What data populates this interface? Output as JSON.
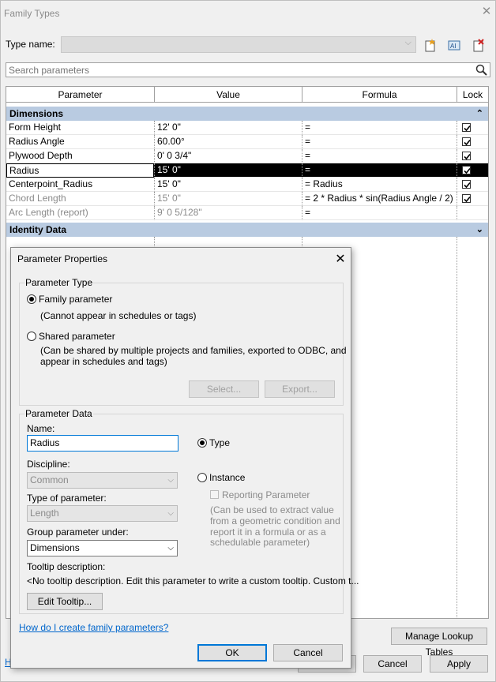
{
  "family_types": {
    "title": "Family Types",
    "type_name_label": "Type name:",
    "type_name_value": "",
    "search_placeholder": "Search parameters",
    "columns": [
      "Parameter",
      "Value",
      "Formula",
      "Lock"
    ],
    "groups": {
      "dimensions": "Dimensions",
      "identity": "Identity Data"
    },
    "rows": [
      {
        "parameter": "Form Height",
        "value": "12'  0\"",
        "formula": "=",
        "lock": true
      },
      {
        "parameter": "Radius Angle",
        "value": "60.00°",
        "formula": "=",
        "lock": true
      },
      {
        "parameter": "Plywood Depth",
        "value": "0'  0 3/4\"",
        "formula": "=",
        "lock": true
      },
      {
        "parameter": "Radius",
        "value": "15'  0\"",
        "formula": "=",
        "lock": true
      },
      {
        "parameter": "Centerpoint_Radius",
        "value": "15'  0\"",
        "formula": "= Radius",
        "lock": true
      },
      {
        "parameter": "Chord Length",
        "value": "15'  0\"",
        "formula": "= 2 * Radius * sin(Radius Angle / 2)",
        "lock": true
      },
      {
        "parameter": "Arc Length (report)",
        "value": "9'  0 5/128\"",
        "formula": "=",
        "lock": false
      }
    ],
    "manage_lookup_label": "Manage Lookup Tables",
    "ok_partial": "H",
    "cancel_label": "Cancel",
    "apply_label": "Apply"
  },
  "dialog": {
    "title": "Parameter Properties",
    "parameter_type_label": "Parameter Type",
    "family_param_label": "Family parameter",
    "family_param_note": "(Cannot appear in schedules or tags)",
    "shared_param_label": "Shared parameter",
    "shared_param_note_1": "(Can be shared by multiple projects and families, exported to ODBC, and",
    "shared_param_note_2": "appear in schedules and tags)",
    "select_label": "Select...",
    "export_label": "Export...",
    "parameter_data_label": "Parameter Data",
    "name_label": "Name:",
    "name_value": "Radius",
    "discipline_label": "Discipline:",
    "discipline_value": "Common",
    "type_of_param_label": "Type of parameter:",
    "type_of_param_value": "Length",
    "group_under_label": "Group parameter under:",
    "group_under_value": "Dimensions",
    "type_radio_label": "Type",
    "instance_radio_label": "Instance",
    "reporting_label": "Reporting Parameter",
    "reporting_note_1": "(Can be used to extract value",
    "reporting_note_2": "from a geometric condition and",
    "reporting_note_3": "report it in a formula or as a",
    "reporting_note_4": "schedulable parameter)",
    "tooltip_label": "Tooltip description:",
    "tooltip_value": "<No tooltip description. Edit this parameter to write a custom tooltip. Custom t...",
    "edit_tooltip_label": "Edit Tooltip...",
    "help_link": "How do I create family parameters?",
    "ok_label": "OK",
    "cancel_label": "Cancel"
  }
}
